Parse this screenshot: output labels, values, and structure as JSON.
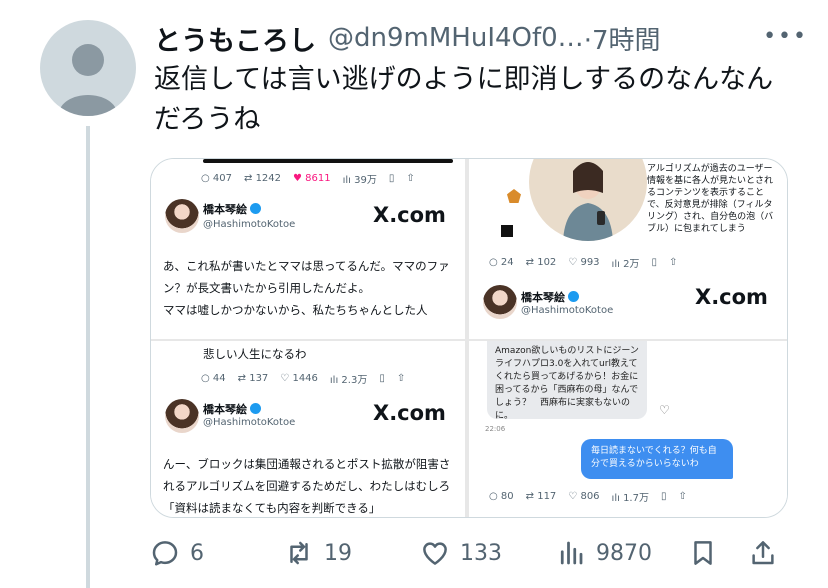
{
  "tweet": {
    "display_name": "とうもころし",
    "handle": "@dn9mMHuI4Of0…",
    "time": "·7時間",
    "more_icon": "more-icon",
    "text": "返信しては言い逃げのように即消しするのなんなんだろうね"
  },
  "media": {
    "top_left": {
      "stats": {
        "replies": "407",
        "retweets": "1242",
        "likes": "8611",
        "views": "39万"
      },
      "author_name": "橋本琴絵",
      "author_handle": "@HashimotoKotoe",
      "site": "X.com",
      "text": "あ、これ私が書いたとママは思ってるんだ。ママのファン？が長文書いたから引用したんだよ。\nママは嘘しかつかないから、私たちちゃんとした人"
    },
    "top_right": {
      "illustration_caption": "アルゴリズムが過去のユーザー情報を基に各人が見たいとされるコンテンツを表示することで、反対意見が排除（フィルタリング）され、自分色の泡（バブル）に包まれてしまう",
      "stats": {
        "replies": "24",
        "retweets": "102",
        "likes": "993",
        "views": "2万"
      },
      "author_name": "橋本琴絵",
      "author_handle": "@HashimotoKotoe",
      "site": "X.com"
    },
    "bottom_left": {
      "top_text": "悲しい人生になるわ",
      "stats": {
        "replies": "44",
        "retweets": "137",
        "likes": "1446",
        "views": "2.3万"
      },
      "author_name": "橋本琴絵",
      "author_handle": "@HashimotoKotoe",
      "site": "X.com",
      "text": "んー、ブロックは集団通報されるとポスト拡散が阻害されるアルゴリズムを回避するためだし、わたしはむしろ「資料は読まなくても内容を判断できる」"
    },
    "bottom_right": {
      "incoming_message": "Amazon欲しいものリストにジーンライフハプロ3.0を入れてurl教えてくれたら買ってあげるから！お金に困ってるから「西麻布の母」なんでしょう？　西麻布に実家もないのに。",
      "message_time": "22:06",
      "outgoing_message": "毎日読まないでくれる？何も自分で買えるからいらないわ",
      "stats": {
        "replies": "80",
        "retweets": "117",
        "likes": "806",
        "views": "1.7万"
      }
    }
  },
  "actions": {
    "replies": "6",
    "retweets": "19",
    "likes": "133",
    "views": "9870"
  },
  "colors": {
    "text": "#0f1419",
    "secondary": "#536471",
    "like_pink": "#f91880",
    "verified_blue": "#1d9bf0",
    "dm_blue": "#3e8ef0"
  }
}
